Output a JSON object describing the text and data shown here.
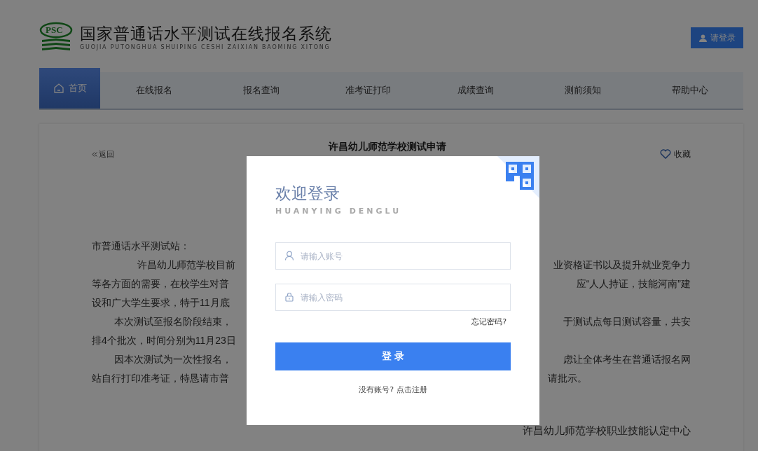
{
  "header": {
    "title": "国家普通话水平测试在线报名系统",
    "subtitle": "GUOJIA PUTONGHUA SHUIPING CESHI ZAIXIAN BAOMING XITONG",
    "logo_text": "PSC",
    "login_button": "请登录"
  },
  "nav": [
    {
      "label": "首页",
      "selected": true
    },
    {
      "label": "在线报名",
      "selected": false
    },
    {
      "label": "报名查询",
      "selected": false
    },
    {
      "label": "准考证打印",
      "selected": false
    },
    {
      "label": "成绩查询",
      "selected": false
    },
    {
      "label": "测前须知",
      "selected": false
    },
    {
      "label": "帮助中心",
      "selected": false
    }
  ],
  "article": {
    "back": "返回",
    "title": "许昌幼儿师范学校测试申请",
    "favorite": "收藏",
    "lines": [
      {
        "kind": "plain",
        "left": "市普通话水平测试站："
      },
      {
        "kind": "indent_wide",
        "left": "许昌幼儿师范学校目前",
        "right": "业资格证书以及提升就业竞争力"
      },
      {
        "kind": "plain",
        "left": "等各方面的需要，在校学生对普",
        "right": "应“人人持证，技能河南”建"
      },
      {
        "kind": "plain",
        "left": "设和广大学生要求，特于11月底"
      },
      {
        "kind": "indent",
        "left": "本次测试至报名阶段结束，",
        "right": "于测试点每日测试容量，共安"
      },
      {
        "kind": "plain",
        "left": "排4个批次，时间分别为11月23日"
      },
      {
        "kind": "indent",
        "left": "因本次测试为一次性报名，",
        "right": "虑让全体考生在普通话报名网"
      },
      {
        "kind": "para_end",
        "left": "站自行打印准考证，特恳请市普",
        "right": "请批示。"
      }
    ],
    "signature": "许昌幼儿师范学校职业技能认定中心"
  },
  "login_dialog": {
    "title": "欢迎登录",
    "subtitle": "HUANYING DENGLU",
    "account": {
      "placeholder": "请输入账号"
    },
    "password": {
      "placeholder": "请输入密码"
    },
    "forgot": "忘记密码?",
    "submit": "登 录",
    "register": "没有账号? 点击注册"
  }
}
